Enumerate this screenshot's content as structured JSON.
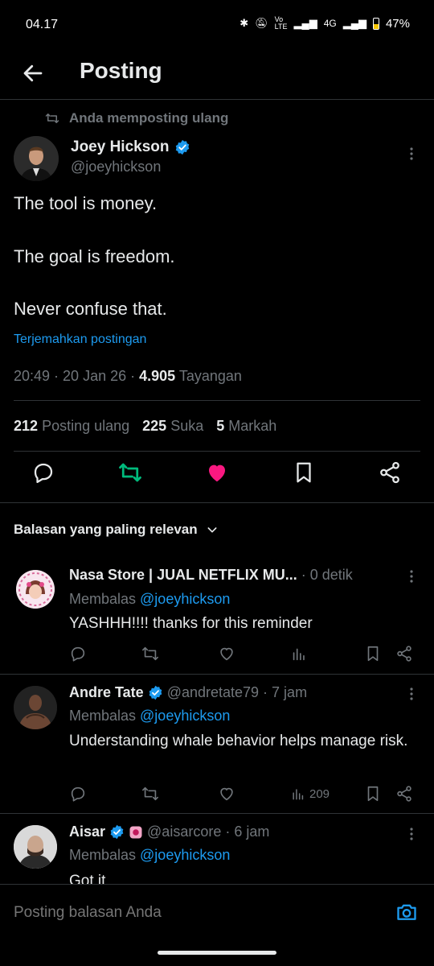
{
  "status": {
    "time": "04.17",
    "network": "4G",
    "battery": "47%"
  },
  "header": {
    "title": "Posting"
  },
  "post": {
    "repost_label": "Anda memposting ulang",
    "author_name": "Joey Hickson",
    "author_handle": "@joeyhickson",
    "lines": [
      "The tool is money.",
      "The goal is freedom.",
      "Never confuse that."
    ],
    "translate": "Terjemahkan postingan",
    "time": "20:49 · 20 Jan 26 · ",
    "views_count": "4.905",
    "views_label": " Tayangan",
    "stats": {
      "reposts": "212",
      "reposts_label": "Posting ulang",
      "likes": "225",
      "likes_label": "Suka",
      "bookmarks": "5",
      "bookmarks_label": "Markah"
    }
  },
  "sort_label": "Balasan yang paling relevan",
  "replies": [
    {
      "name": "Nasa Store | JUAL NETFLIX MU...",
      "handle": "",
      "time": "· 0 detik",
      "reply_prefix": "Membalas ",
      "reply_to": "@joeyhickson",
      "text": "YASHHH!!!! thanks for this reminder",
      "views": ""
    },
    {
      "name": "Andre Tate",
      "handle": "@andretate79",
      "time": "· 7 jam",
      "reply_prefix": "Membalas ",
      "reply_to": "@joeyhickson",
      "text": "Understanding whale behavior helps manage risk.",
      "views": "209"
    },
    {
      "name": "Aisar",
      "handle": "@aisarcore",
      "time": "· 6 jam",
      "reply_prefix": "Membalas ",
      "reply_to": "@joeyhickson",
      "text": "Got it",
      "views": ""
    }
  ],
  "composer": {
    "placeholder": "Posting balasan Anda"
  },
  "colors": {
    "accent": "#1d9bf0",
    "repost_green": "#00ba7c",
    "like_pink": "#f91880",
    "background": "#000000"
  }
}
